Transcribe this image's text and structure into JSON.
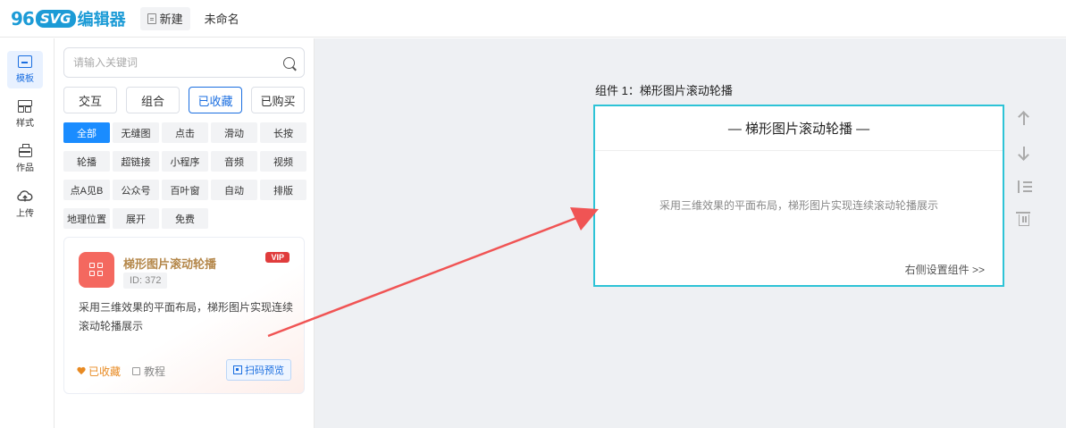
{
  "header": {
    "logo_number": "96",
    "logo_badge": "SVG",
    "logo_text": "编辑器",
    "new_label": "新建",
    "doc_title": "未命名"
  },
  "iconbar": {
    "items": [
      {
        "label": "模板",
        "icon": "template-icon",
        "active": true
      },
      {
        "label": "样式",
        "icon": "style-icon"
      },
      {
        "label": "作品",
        "icon": "works-icon"
      },
      {
        "label": "上传",
        "icon": "upload-cloud-icon"
      }
    ]
  },
  "search": {
    "placeholder": "请输入关键词"
  },
  "tabs": [
    {
      "label": "交互"
    },
    {
      "label": "组合"
    },
    {
      "label": "已收藏",
      "active": true
    },
    {
      "label": "已购买"
    }
  ],
  "filters": [
    {
      "label": "全部",
      "active": true
    },
    {
      "label": "无缝图"
    },
    {
      "label": "点击"
    },
    {
      "label": "滑动"
    },
    {
      "label": "长按"
    },
    {
      "label": "轮播"
    },
    {
      "label": "超链接"
    },
    {
      "label": "小程序"
    },
    {
      "label": "音频"
    },
    {
      "label": "视频"
    },
    {
      "label": "点A见B"
    },
    {
      "label": "公众号"
    },
    {
      "label": "百叶窗"
    },
    {
      "label": "自动"
    },
    {
      "label": "排版"
    },
    {
      "label": "地理位置"
    },
    {
      "label": "展开"
    },
    {
      "label": "免费"
    }
  ],
  "card": {
    "title": "梯形图片滚动轮播",
    "id_text": "ID: 372",
    "badge": "VIP",
    "description": "采用三维效果的平面布局，梯形图片实现连续滚动轮播展示",
    "favorite_label": "已收藏",
    "tutorial_label": "教程",
    "preview_label": "扫码预览",
    "accent_color": "#f4685f"
  },
  "canvas": {
    "component_label": "组件 1：梯形图片滚动轮播",
    "component_title": "— 梯形图片滚动轮播 —",
    "component_desc": "采用三维效果的平面布局，梯形图片实现连续滚动轮播展示",
    "component_link": "右侧设置组件 >>",
    "border_color": "#2dc3d6",
    "tools": [
      "move-up-icon",
      "move-down-icon",
      "spacing-icon",
      "delete-icon"
    ]
  },
  "colors": {
    "primary": "#1a6ee0",
    "brand": "#1c9bd6",
    "annotation_arrow": "#f05454"
  }
}
